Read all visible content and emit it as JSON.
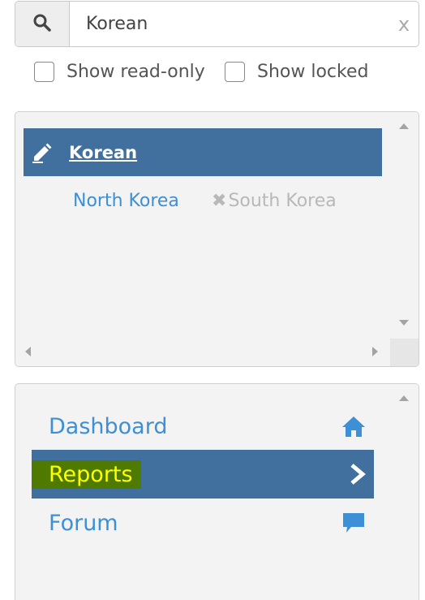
{
  "search": {
    "value": "Korean",
    "clear_label": "x",
    "search_icon": "search-icon"
  },
  "filters": {
    "read_only_label": "Show read-only",
    "read_only_checked": false,
    "locked_label": "Show locked",
    "locked_checked": false
  },
  "results": {
    "title": "Korean",
    "title_icon": "pencil-icon",
    "variants": [
      {
        "label": "North Korea",
        "state": "available"
      },
      {
        "label": "South Korea",
        "state": "removed",
        "icon": "x-icon"
      }
    ]
  },
  "nav": {
    "items": [
      {
        "label": "Dashboard",
        "icon": "home-icon",
        "active": false
      },
      {
        "label": "Reports",
        "icon": "chevron-right-icon",
        "active": true
      },
      {
        "label": "Forum",
        "icon": "comment-icon",
        "active": false
      }
    ]
  },
  "colors": {
    "accent": "#42709e",
    "link": "#3d8fd6",
    "highlight_text": "#ffff00",
    "highlight_bg": "#4f7a00",
    "disabled": "#b8b8b8"
  }
}
